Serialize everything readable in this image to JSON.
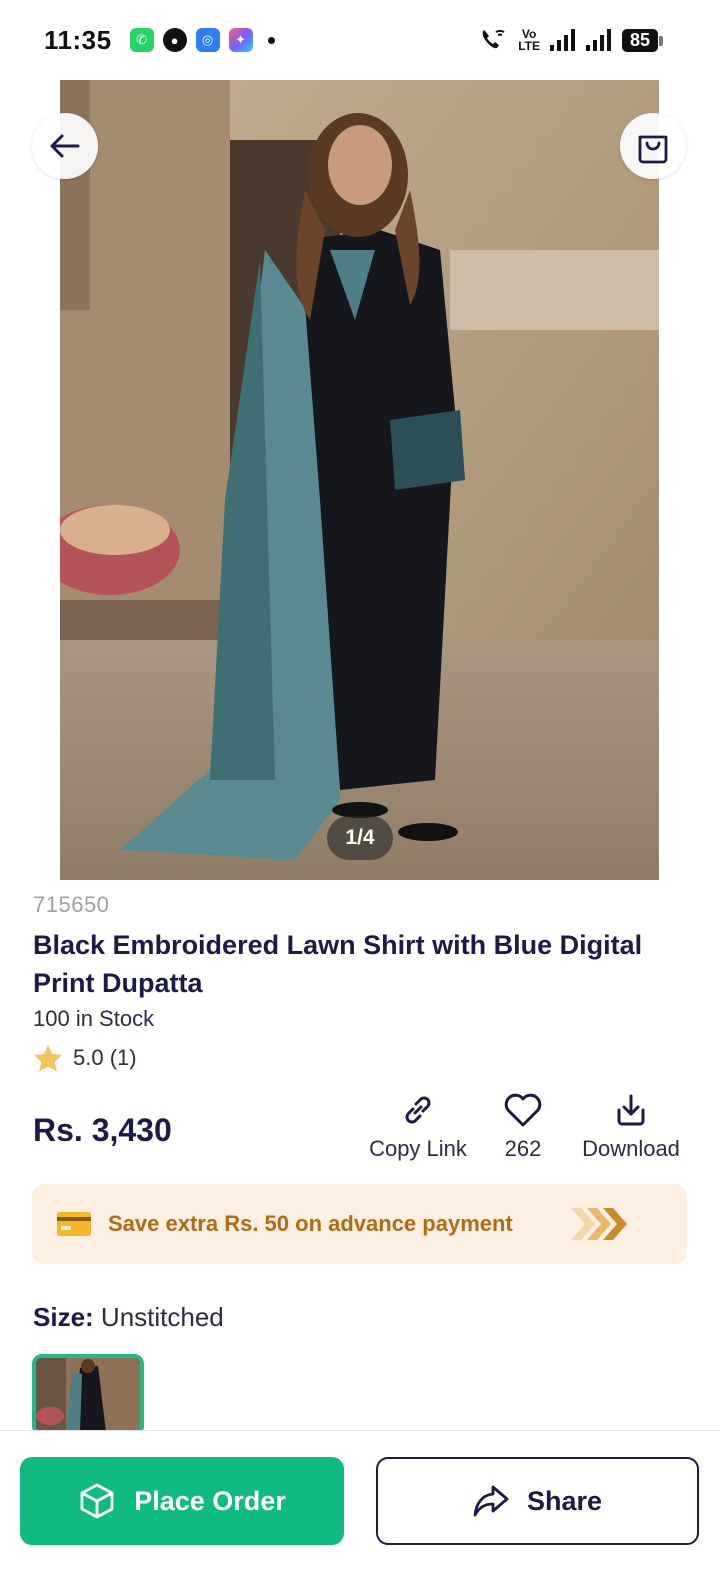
{
  "status_bar": {
    "time": "11:35",
    "volte_top": "Vo",
    "volte_bottom": "LTE",
    "battery": "85",
    "apps": [
      "whatsapp-icon",
      "messenger-icon",
      "app-icon",
      "gallery-icon"
    ]
  },
  "product": {
    "sku": "715650",
    "title": "Black Embroidered Lawn Shirt with Blue Digital Print Dupatta",
    "stock": "100 in Stock",
    "rating": "5.0 (1)",
    "price": "Rs. 3,430",
    "image_pager": "1/4"
  },
  "actions": {
    "copy_link": "Copy Link",
    "likes": "262",
    "download": "Download"
  },
  "promo": {
    "text": "Save extra Rs. 50 on advance payment"
  },
  "size": {
    "label": "Size:",
    "value": "Unstitched"
  },
  "bottom": {
    "place_order": "Place Order",
    "share": "Share"
  },
  "colors": {
    "accent_green": "#10bb80",
    "navy": "#1b1b4b",
    "promo_bg": "#fdf0e0",
    "promo_text": "#b36a12"
  }
}
